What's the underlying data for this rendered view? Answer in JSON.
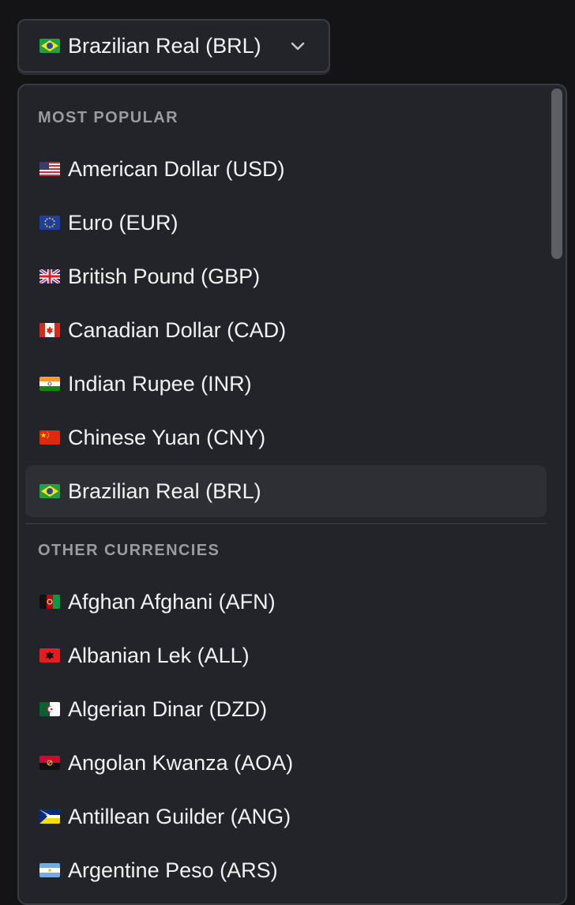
{
  "trigger": {
    "flag_icon": "brazil-flag-icon",
    "label": "Brazilian Real (BRL)",
    "chevron_icon": "chevron-down-icon"
  },
  "dropdown": {
    "groups": [
      {
        "header": "MOST POPULAR",
        "items": [
          {
            "label": "American Dollar (USD)",
            "flag": "usa-flag-icon"
          },
          {
            "label": "Euro (EUR)",
            "flag": "eu-flag-icon"
          },
          {
            "label": "British Pound (GBP)",
            "flag": "uk-flag-icon"
          },
          {
            "label": "Canadian Dollar (CAD)",
            "flag": "canada-flag-icon"
          },
          {
            "label": "Indian Rupee (INR)",
            "flag": "india-flag-icon"
          },
          {
            "label": "Chinese Yuan (CNY)",
            "flag": "china-flag-icon"
          },
          {
            "label": "Brazilian Real (BRL)",
            "flag": "brazil-flag-icon",
            "selected": true
          }
        ]
      },
      {
        "header": "OTHER CURRENCIES",
        "items": [
          {
            "label": "Afghan Afghani (AFN)",
            "flag": "afghanistan-flag-icon"
          },
          {
            "label": "Albanian Lek (ALL)",
            "flag": "albania-flag-icon"
          },
          {
            "label": "Algerian Dinar (DZD)",
            "flag": "algeria-flag-icon"
          },
          {
            "label": "Angolan Kwanza (AOA)",
            "flag": "angola-flag-icon"
          },
          {
            "label": "Antillean Guilder (ANG)",
            "flag": "antilles-flag-icon"
          },
          {
            "label": "Argentine Peso (ARS)",
            "flag": "argentina-flag-icon"
          }
        ]
      }
    ]
  },
  "colors": {
    "page_background": "#141416",
    "surface": "#232429",
    "border": "#3b3c42",
    "selected_row": "#2e2f35",
    "text_primary": "#f2f2f4",
    "text_header": "#9a9ba1"
  }
}
